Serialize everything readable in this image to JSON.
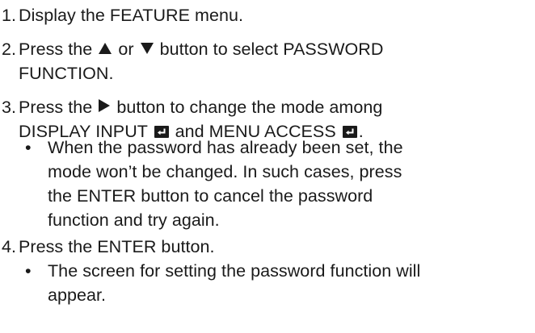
{
  "steps": [
    {
      "num": "1.",
      "text": "Display the FEATURE menu."
    },
    {
      "num": "2.",
      "before": "Press the ",
      "up_icon": "up-triangle",
      "mid": " or ",
      "down_icon": "down-triangle",
      "after_line1": " button to select PASSWORD",
      "line2": "FUNCTION."
    },
    {
      "num": "3.",
      "before": "Press the ",
      "right_icon": "right-triangle",
      "after_line1": " button to change the mode among",
      "line2_a": "DISPLAY INPUT ",
      "enter_icon": "enter-return-icon",
      "line2_b": " and MENU ACCESS ",
      "line2_c": ".",
      "bullet": {
        "dot": "•",
        "lines": [
          "When the password has already been set, the",
          "mode won’t be changed. In such cases, press",
          "the ENTER button to cancel the password",
          "function and try again."
        ]
      }
    },
    {
      "num": "4.",
      "text": "Press the ENTER button.",
      "bullet": {
        "dot": "•",
        "lines": [
          "The screen for setting the password function will",
          "appear."
        ]
      }
    }
  ]
}
